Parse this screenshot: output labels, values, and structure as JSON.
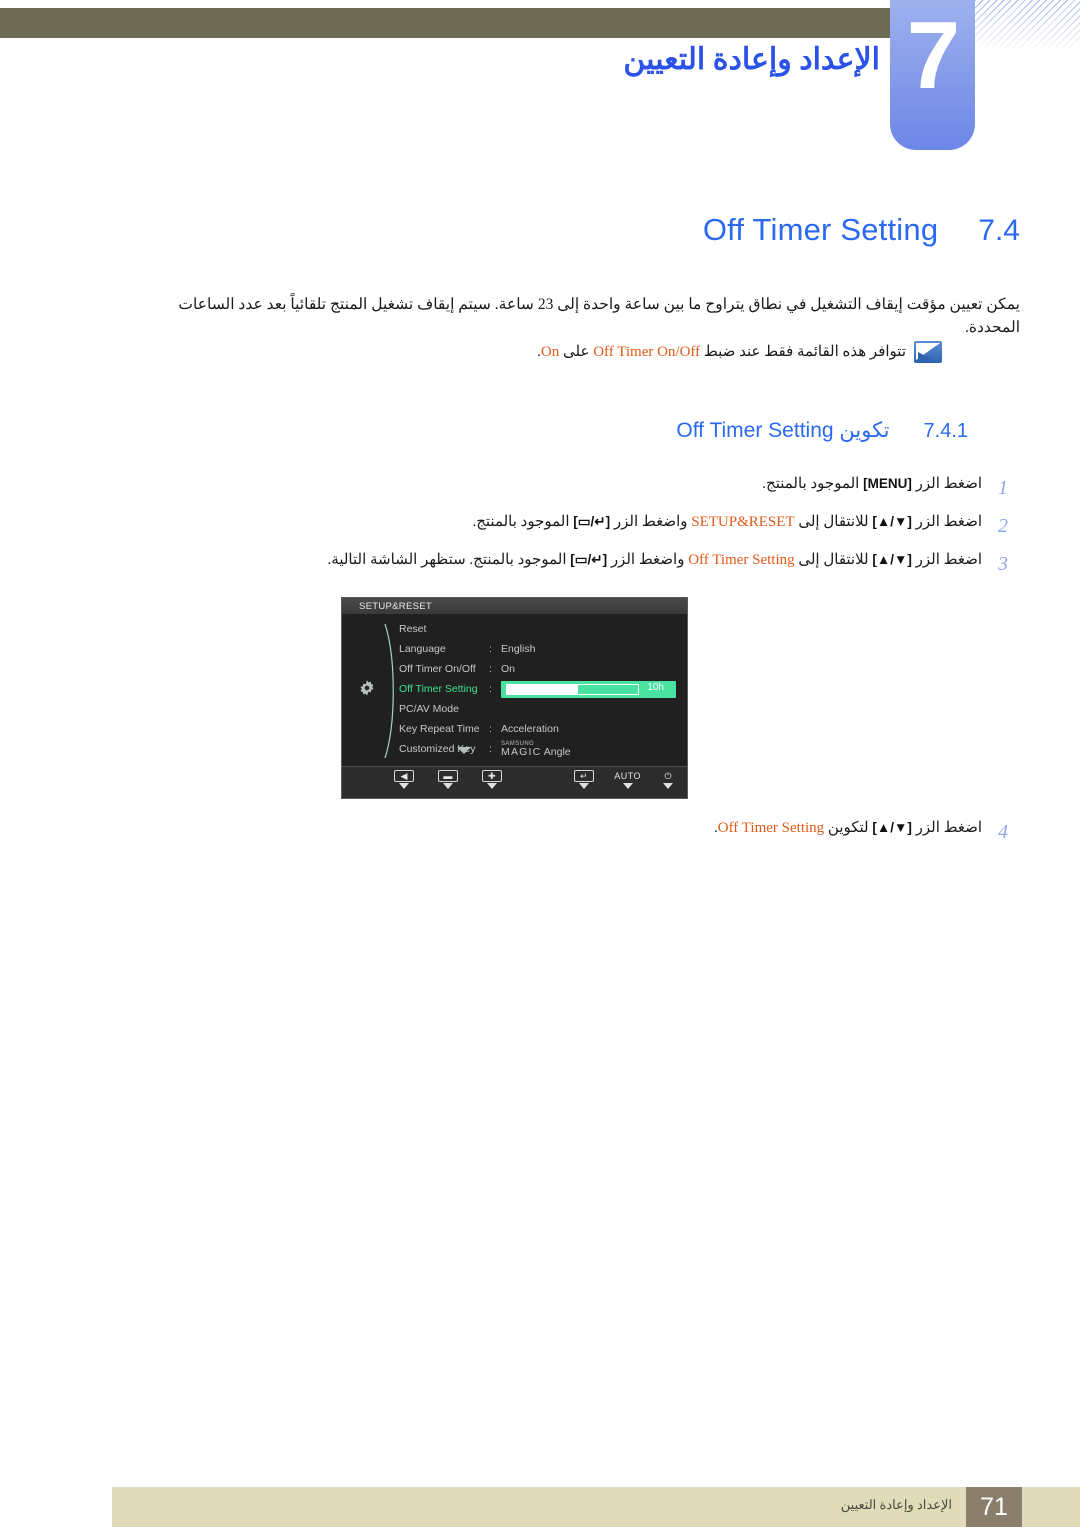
{
  "header": {
    "chapter_number": "7",
    "chapter_title": "الإعداد وإعادة التعيين"
  },
  "section": {
    "title": "Off Timer Setting",
    "number": "7.4",
    "intro": "يمكن تعيين مؤقت إيقاف التشغيل في نطاق يتراوح ما بين ساعة واحدة إلى 23 ساعة. سيتم إيقاف تشغيل المنتج تلقائياً بعد عدد الساعات المحددة.",
    "note": {
      "icon": "note-pencil-icon",
      "prefix": "تتوافر هذه القائمة فقط عند ضبط ",
      "highlight1": "Off Timer On/Off",
      "middle": " على ",
      "highlight2": "On",
      "suffix": "."
    }
  },
  "subsection": {
    "number": "7.4.1",
    "label_ar": "تكوين",
    "label_en": "Off Timer Setting"
  },
  "steps": [
    {
      "num": "1",
      "part1": "اضغط الزر ",
      "key1": "[MENU]",
      "part2": " الموجود بالمنتج."
    },
    {
      "num": "2",
      "part1": "اضغط الزر ",
      "key1": "[▲/▼]",
      "part2": " للانتقال إلى ",
      "highlight": "SETUP&RESET",
      "part3": " واضغط الزر ",
      "key2": "[▭/↵]",
      "part4": " الموجود بالمنتج."
    },
    {
      "num": "3",
      "part1": "اضغط الزر ",
      "key1": "[▲/▼]",
      "part2": " للانتقال إلى ",
      "highlight": "Off Timer Setting",
      "part3": " واضغط الزر ",
      "key2": "[▭/↵]",
      "part4": " الموجود بالمنتج. ستظهر الشاشة التالية."
    },
    {
      "num": "4",
      "part1": "اضغط الزر ",
      "key1": "[▲/▼]",
      "part2": " لتكوين ",
      "highlight": "Off Timer Setting",
      "part3": "."
    }
  ],
  "osd": {
    "title": "SETUP&RESET",
    "gear_icon": "gear-icon",
    "rows": [
      {
        "label": "Reset",
        "colon": "",
        "value": ""
      },
      {
        "label": "Language",
        "colon": ":",
        "value": "English"
      },
      {
        "label": "Off Timer On/Off",
        "colon": ":",
        "value": "On"
      },
      {
        "label": "Off Timer Setting",
        "colon": ":",
        "value": "",
        "slider": true,
        "slider_label": "10h",
        "slider_fill_percent": 54,
        "active": true
      },
      {
        "label": "PC/AV Mode",
        "colon": "",
        "value": ""
      },
      {
        "label": "Key Repeat Time",
        "colon": ":",
        "value": "Acceleration"
      },
      {
        "label": "Customized Key",
        "colon": ":",
        "value": "",
        "magic": true,
        "magic_small": "SAMSUNG",
        "magic_big": "MAGIC",
        "magic_suffix": "Angle"
      }
    ],
    "scroll_icon": "chevron-down-icon",
    "buttons": [
      {
        "name": "back-button",
        "glyph": "◀",
        "type": "box"
      },
      {
        "name": "minus-button",
        "glyph": "▬",
        "type": "box"
      },
      {
        "name": "plus-button",
        "glyph": "✚",
        "type": "box"
      },
      {
        "name": "enter-button",
        "glyph": "↵",
        "type": "box"
      },
      {
        "name": "auto-button",
        "glyph": "AUTO",
        "type": "text"
      },
      {
        "name": "power-button",
        "glyph": "⏻",
        "type": "text"
      }
    ],
    "colors": {
      "highlight_green": "#4ae2a0",
      "active_label": "#3fe08a",
      "background": "#202020"
    }
  },
  "footer": {
    "text": "الإعداد وإعادة التعيين",
    "page": "71"
  },
  "colors": {
    "accent_blue": "#2b6af0",
    "highlight_orange": "#e05a18",
    "header_bar": "#6d6a56",
    "footer_bar": "#e0dcb9",
    "footer_page_box": "#8a7f6d"
  }
}
